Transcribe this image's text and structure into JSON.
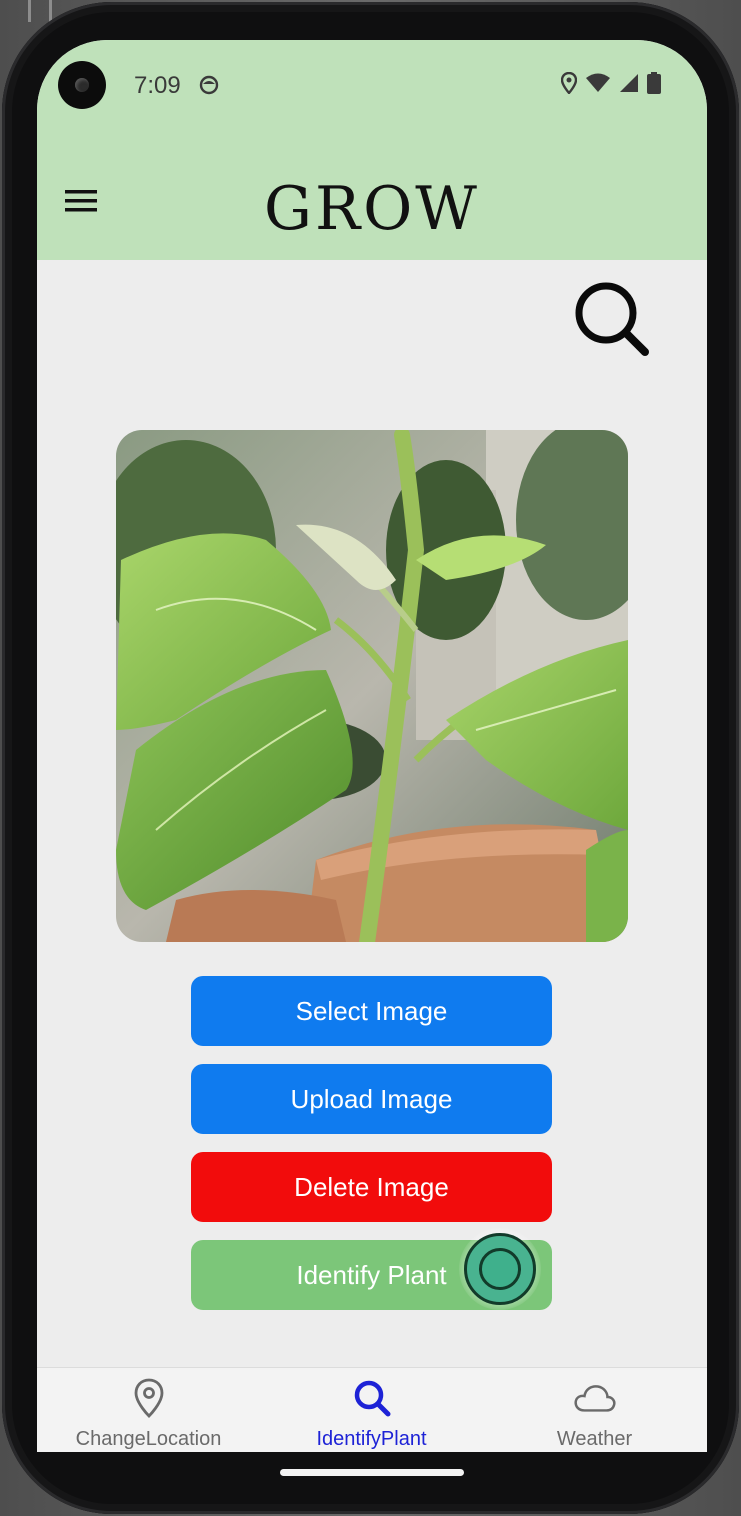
{
  "status_bar": {
    "time": "7:09",
    "icons": [
      "face-icon",
      "location-icon",
      "wifi-icon",
      "signal-icon",
      "battery-icon"
    ]
  },
  "app_bar": {
    "title": "GROW",
    "menu_icon": "hamburger-menu-icon"
  },
  "main": {
    "search_icon": "search-icon",
    "photo_alt": "",
    "buttons": {
      "select": "Select Image",
      "upload": "Upload Image",
      "delete": "Delete Image",
      "identify": "Identify Plant"
    }
  },
  "bottom_nav": {
    "items": [
      {
        "label": "ChangeLocation",
        "icon": "location-pin-icon",
        "active": false
      },
      {
        "label": "IdentifyPlant",
        "icon": "search-icon",
        "active": true
      },
      {
        "label": "Weather",
        "icon": "cloud-icon",
        "active": false
      }
    ]
  },
  "colors": {
    "app_bar_bg": "#bfe1ba",
    "select_btn": "#0f7bef",
    "upload_btn": "#0f7bef",
    "delete_btn": "#f20c0c",
    "identify_btn": "#7cc679",
    "active_nav": "#1d22d6"
  }
}
